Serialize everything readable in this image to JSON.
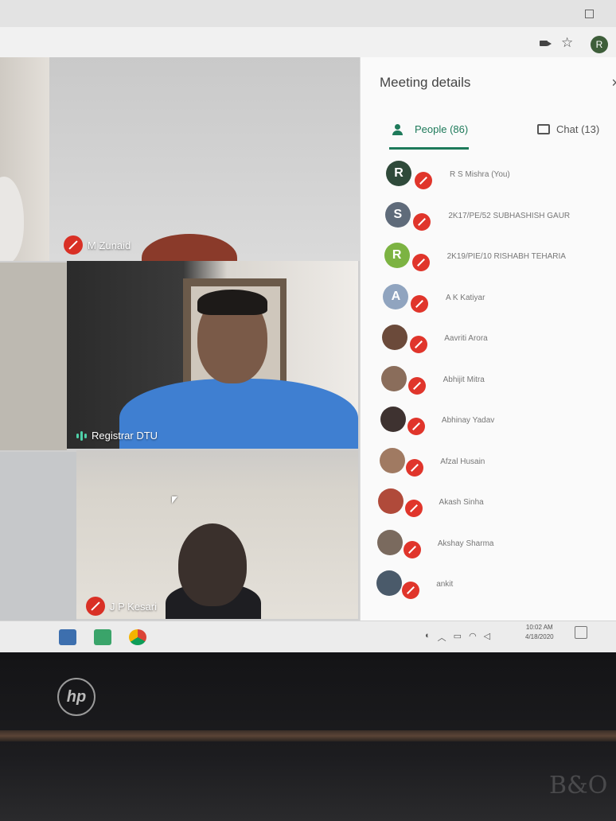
{
  "browser": {
    "profile_initial": "R",
    "star_glyph": "☆"
  },
  "video_tiles": [
    {
      "name": "M Zunaid",
      "muted": true
    },
    {
      "name": "Registrar DTU",
      "muted": false,
      "speaking": true
    },
    {
      "name": "J P Kesari",
      "muted": true
    }
  ],
  "panel": {
    "title": "Meeting details",
    "close_glyph": "×",
    "tabs": [
      {
        "label": "People (86)",
        "active": true
      },
      {
        "label": "Chat (13)",
        "active": false
      }
    ],
    "participants": [
      {
        "name": "R S Mishra (You)",
        "initial": "R",
        "color": "#2f4a3a"
      },
      {
        "name": "2K17/PE/52 SUBHASHISH GAUR",
        "initial": "S",
        "color": "#5f6b7a"
      },
      {
        "name": "2K19/PIE/10 RISHABH TEHARIA",
        "initial": "R",
        "color": "#7cb342"
      },
      {
        "name": "A K Katiyar",
        "initial": "A",
        "color": "#90a4bf"
      },
      {
        "name": "Aavriti Arora",
        "initial": "",
        "color": "#6b4a3a"
      },
      {
        "name": "Abhijit Mitra",
        "initial": "",
        "color": "#8a6d5b"
      },
      {
        "name": "Abhinay Yadav",
        "initial": "",
        "color": "#3e3230"
      },
      {
        "name": "Afzal Husain",
        "initial": "",
        "color": "#a07a62"
      },
      {
        "name": "Akash Sinha",
        "initial": "",
        "color": "#b04a3a"
      },
      {
        "name": "Akshay Sharma",
        "initial": "",
        "color": "#7a6a5e"
      },
      {
        "name": "ankit",
        "initial": "",
        "color": "#4a5a6a"
      }
    ]
  },
  "taskbar": {
    "time": "10:02 AM",
    "date": "4/18/2020"
  },
  "laptop": {
    "brand_logo_text": "hp",
    "speaker_logo_text": "B&O"
  }
}
